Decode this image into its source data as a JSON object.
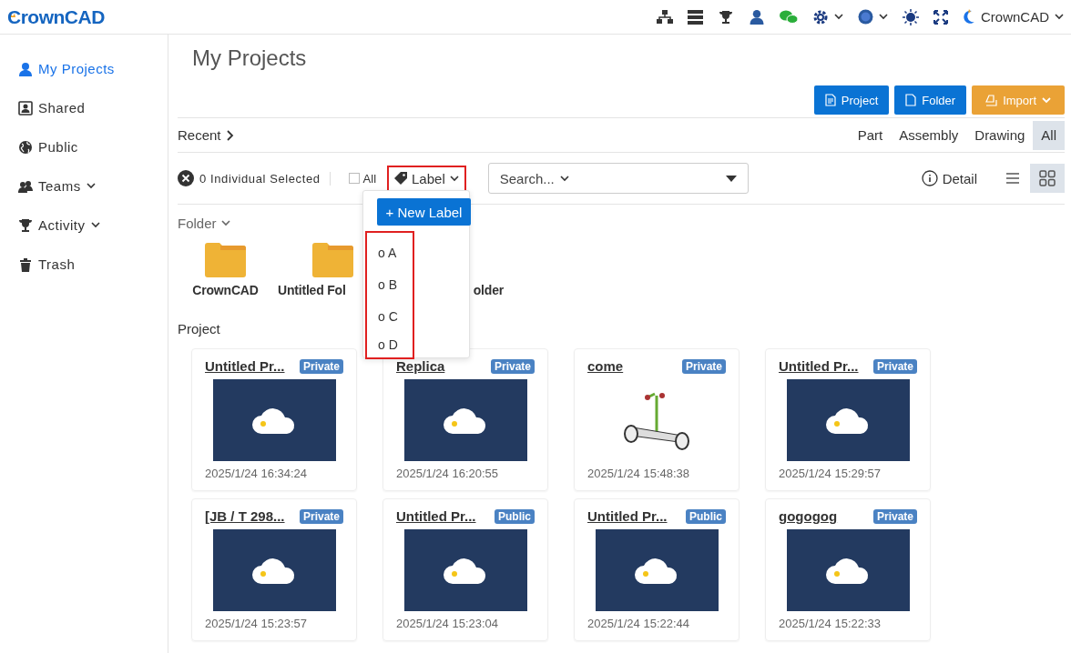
{
  "header": {
    "logo": "CrownCAD",
    "user": "CrownCAD"
  },
  "sidebar": {
    "items": [
      {
        "label": "My Projects",
        "kind": "user",
        "selected": true,
        "caret": false
      },
      {
        "label": "Shared",
        "kind": "share",
        "selected": false,
        "caret": false
      },
      {
        "label": "Public",
        "kind": "globe",
        "selected": false,
        "caret": false
      },
      {
        "label": "Teams",
        "kind": "team",
        "selected": false,
        "caret": true
      },
      {
        "label": "Activity",
        "kind": "trophy",
        "selected": false,
        "caret": true
      },
      {
        "label": "Trash",
        "kind": "trash",
        "selected": false,
        "caret": false
      }
    ]
  },
  "page_title": "My Projects",
  "actions": [
    {
      "label": "Project",
      "kind": "primary"
    },
    {
      "label": "Folder",
      "kind": "primary"
    },
    {
      "label": "Import",
      "kind": "warning"
    }
  ],
  "recent": "Recent",
  "type_filters": [
    {
      "label": "Part",
      "selected": false
    },
    {
      "label": "Assembly",
      "selected": false
    },
    {
      "label": "Drawing",
      "selected": false
    },
    {
      "label": "All",
      "selected": true
    }
  ],
  "toolbar": {
    "selected_count": "0 Individual Selected",
    "all_checkbox": {
      "label": "All",
      "checked": false
    },
    "label_button": "Label",
    "search_placeholder": "Search...",
    "detail": "Detail"
  },
  "views": [
    {
      "kind": "list",
      "selected": false
    },
    {
      "kind": "grid",
      "selected": true
    }
  ],
  "label_menu": {
    "new_label": "+ New Label",
    "items": [
      "o A",
      "o B",
      "o C",
      "o D"
    ]
  },
  "folders_heading": "Folder",
  "folders": [
    "CrownCAD",
    "Untitled Fol",
    "older"
  ],
  "projects_heading": "Project",
  "projects": [
    {
      "title": "Untitled Pr...",
      "badge": "Private",
      "kind": "cloud",
      "date": "2025/1/24 16:34:24"
    },
    {
      "title": "Replica",
      "badge": "Private",
      "kind": "cloud",
      "date": "2025/1/24 16:20:55"
    },
    {
      "title": "come",
      "badge": "Private",
      "kind": "model",
      "date": "2025/1/24 15:48:38"
    },
    {
      "title": "Untitled Pr...",
      "badge": "Private",
      "kind": "cloud",
      "date": "2025/1/24 15:29:57"
    },
    {
      "title": "[JB / T 298...",
      "badge": "Private",
      "kind": "cloud",
      "date": "2025/1/24 15:23:57"
    },
    {
      "title": "Untitled Pr...",
      "badge": "Public",
      "kind": "cloud",
      "date": "2025/1/24 15:23:04"
    },
    {
      "title": "Untitled Pr...",
      "badge": "Public",
      "kind": "cloud",
      "date": "2025/1/24 15:22:44"
    },
    {
      "title": "gogogog",
      "badge": "Private",
      "kind": "cloud",
      "date": "2025/1/24 15:22:33"
    }
  ]
}
